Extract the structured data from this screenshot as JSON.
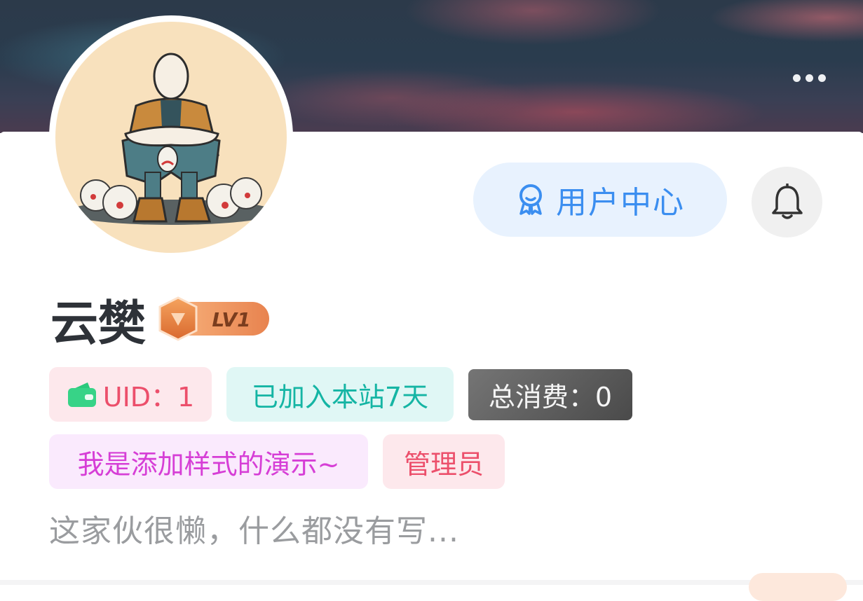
{
  "header": {
    "more_icon": "more-dots-icon",
    "cover_colors": [
      "#2c3a4a",
      "#c9606e",
      "#4b8ea0"
    ]
  },
  "profile": {
    "user_center_label": "用户中心",
    "user_center_icon": "badge-icon",
    "notification_icon": "bell-icon",
    "name": "云樊",
    "level_badge": "LV1",
    "tags": {
      "uid_icon": "wallet-icon",
      "uid": "UID：1",
      "joined": "已加入本站7天",
      "spend": "总消费：0",
      "demo": "我是添加样式的演示~",
      "role": "管理员"
    },
    "bio": "这家伙很懒，什么都没有写..."
  },
  "colors": {
    "accent_blue": "#3b8ef0",
    "uid_pink": "#ec4f6b",
    "join_teal": "#15b5a4",
    "demo_magenta": "#d63ed6",
    "spend_gray": "#5e5e5e"
  }
}
